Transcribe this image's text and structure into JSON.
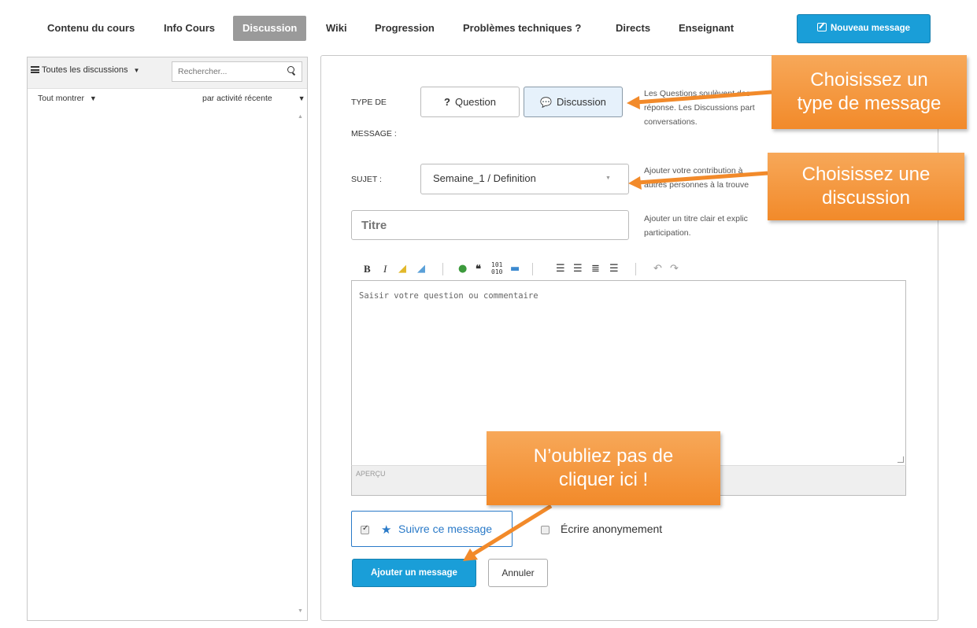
{
  "nav": {
    "tabs": [
      "Contenu du cours",
      "Info Cours",
      "Discussion",
      "Wiki",
      "Progression",
      "Problèmes techniques ?",
      "Directs",
      "Enseignant"
    ],
    "active_tab": "Discussion",
    "new_message_button": "Nouveau message"
  },
  "sidebar": {
    "menu_label": "Toutes les discussions",
    "search_placeholder": "Rechercher...",
    "filter_show": "Tout montrer",
    "filter_sort": "par activité récente"
  },
  "form": {
    "type_label_line1": "TYPE DE",
    "type_label_line2": "MESSAGE :",
    "question_button": "Question",
    "discussion_button": "Discussion",
    "type_help": [
      "Les Questions soulèvent des",
      "réponse. Les Discussions part",
      "conversations."
    ],
    "subject_label": "SUJET :",
    "subject_value": "Semaine_1 / Definition",
    "subject_help": [
      "Ajouter votre contribution à",
      "autres personnes à la trouve"
    ],
    "title_placeholder": "Titre",
    "title_help": [
      "Ajouter un titre clair et explic",
      "participation."
    ],
    "editor_placeholder": "Saisir votre question ou commentaire",
    "preview_label": "APERÇU",
    "follow_label": "Suivre ce message",
    "anonymous_label": "Écrire anonymement",
    "submit_button": "Ajouter un message",
    "cancel_button": "Annuler"
  },
  "callouts": {
    "type": [
      "Choisissez un",
      "type de message"
    ],
    "discussion": [
      "Choisissez une",
      "discussion"
    ],
    "click": [
      "N’oubliez pas de",
      "cliquer ici !"
    ]
  },
  "colors": {
    "primary_button": "#1a9ed8",
    "active_tab": "#9a9a9a",
    "callout": "#f28a2a",
    "link_blue": "#2a7ac8"
  }
}
